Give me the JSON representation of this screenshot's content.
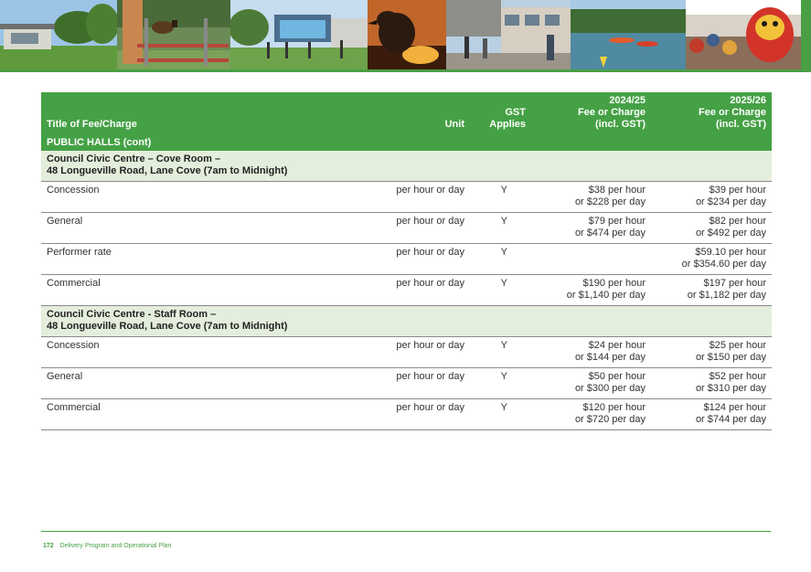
{
  "table": {
    "headers": {
      "title": "Title of Fee/Charge",
      "unit": "Unit",
      "gst_line1": "GST",
      "gst_line2": "Applies",
      "fee_2425_line1": "2024/25",
      "fee_2425_line2": "Fee or Charge",
      "fee_2425_line3": "(incl. GST)",
      "fee_2526_line1": "2025/26",
      "fee_2526_line2": "Fee or Charge",
      "fee_2526_line3": "(incl. GST)"
    },
    "section": "PUBLIC HALLS (cont)",
    "groups": [
      {
        "venue_line1": "Council Civic Centre – Cove Room –",
        "venue_line2": "48 Longueville Road, Lane Cove (7am to Midnight)",
        "rows": [
          {
            "title": "Concession",
            "unit": "per hour or day",
            "gst": "Y",
            "fee_2425": [
              "$38 per hour",
              "or $228 per day"
            ],
            "fee_2526": [
              "$39 per hour",
              "or $234 per day"
            ]
          },
          {
            "title": "General",
            "unit": "per hour or day",
            "gst": "Y",
            "fee_2425": [
              "$79 per hour",
              "or $474 per day"
            ],
            "fee_2526": [
              "$82 per hour",
              "or $492 per day"
            ]
          },
          {
            "title": "Performer rate",
            "unit": "per hour or day",
            "gst": "Y",
            "fee_2425": [
              "",
              ""
            ],
            "fee_2526": [
              "$59.10 per hour",
              "or $354.60 per day"
            ]
          },
          {
            "title": "Commercial",
            "unit": "per hour or day",
            "gst": "Y",
            "fee_2425": [
              "$190 per hour",
              "or $1,140 per day"
            ],
            "fee_2526": [
              "$197 per hour",
              "or $1,182 per day"
            ]
          }
        ]
      },
      {
        "venue_line1": "Council Civic Centre - Staff Room –",
        "venue_line2": "48 Longueville Road,  Lane Cove (7am to Midnight)",
        "rows": [
          {
            "title": "Concession",
            "unit": "per hour or day",
            "gst": "Y",
            "fee_2425": [
              "$24 per hour",
              "or $144 per day"
            ],
            "fee_2526": [
              "$25 per hour",
              "or $150 per day"
            ]
          },
          {
            "title": "General",
            "unit": "per hour or day",
            "gst": "Y",
            "fee_2425": [
              "$50 per hour",
              "or $300 per day"
            ],
            "fee_2526": [
              "$52 per hour",
              "or $310 per day"
            ]
          },
          {
            "title": "Commercial",
            "unit": "per hour or day",
            "gst": "Y",
            "fee_2425": [
              "$120 per hour",
              "or $720 per day"
            ],
            "fee_2526": [
              "$124 per hour",
              "or $744 per day"
            ]
          }
        ]
      }
    ]
  },
  "footer": {
    "page_number": "172",
    "document_title": "Delivery Program and Operational Plan"
  },
  "colors": {
    "brand_green": "#45a145",
    "venue_row_bg": "#e4eedc"
  }
}
